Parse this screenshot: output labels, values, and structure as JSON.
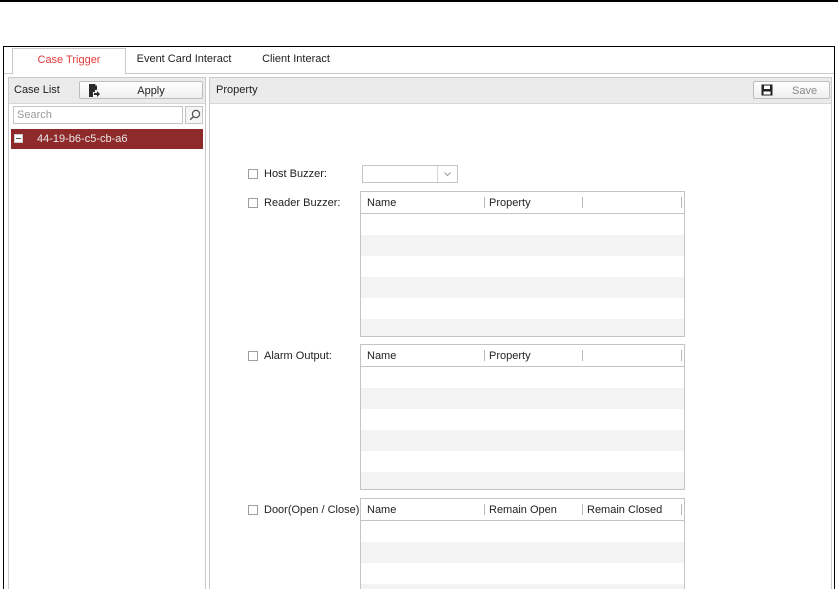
{
  "tabs": [
    {
      "label": "Case Trigger",
      "active": true
    },
    {
      "label": "Event Card Interact",
      "active": false
    },
    {
      "label": "Client Interact",
      "active": false
    }
  ],
  "case_list": {
    "title": "Case List",
    "apply_label": "Apply",
    "search_placeholder": "Search",
    "items": [
      {
        "label": "44-19-b6-c5-cb-a6",
        "selected": true
      }
    ]
  },
  "property": {
    "title": "Property",
    "save_label": "Save",
    "host_buzzer": {
      "label": "Host Buzzer:",
      "checked": false,
      "selected_value": ""
    },
    "reader_buzzer": {
      "label": "Reader Buzzer:",
      "checked": false,
      "columns": [
        "Name",
        "Property"
      ]
    },
    "alarm_output": {
      "label": "Alarm Output:",
      "checked": false,
      "columns": [
        "Name",
        "Property"
      ]
    },
    "door": {
      "label": "Door(Open / Close):",
      "checked": false,
      "columns": [
        "Name",
        "Remain Open",
        "Remain Closed"
      ]
    }
  },
  "colors": {
    "active_tab_text": "#e23a3a",
    "selected_item_bg": "#8f2a2a",
    "panel_header_bg": "#ebebeb"
  }
}
